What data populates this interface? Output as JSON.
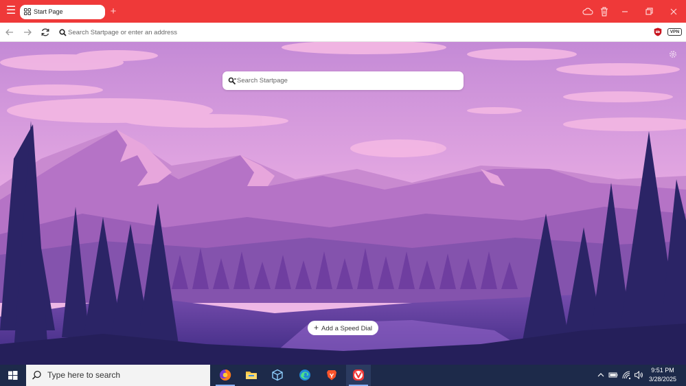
{
  "browser": {
    "tab": {
      "title": "Start Page"
    },
    "address_bar": {
      "placeholder": "Search Startpage or enter an address"
    },
    "vpn_label": "VPN"
  },
  "start_page": {
    "search": {
      "placeholder": "Search Startpage"
    },
    "speed_dial_label": "Add a Speed Dial"
  },
  "taskbar": {
    "search_text": "Type here to search",
    "clock_time": "9:51 PM",
    "clock_date": "3/28/2025"
  },
  "colors": {
    "titlebar": "#ef3939",
    "taskbar": "#1d2a4a",
    "sky_top": "#c98bd7",
    "sky_bottom": "#f2b8e6"
  }
}
